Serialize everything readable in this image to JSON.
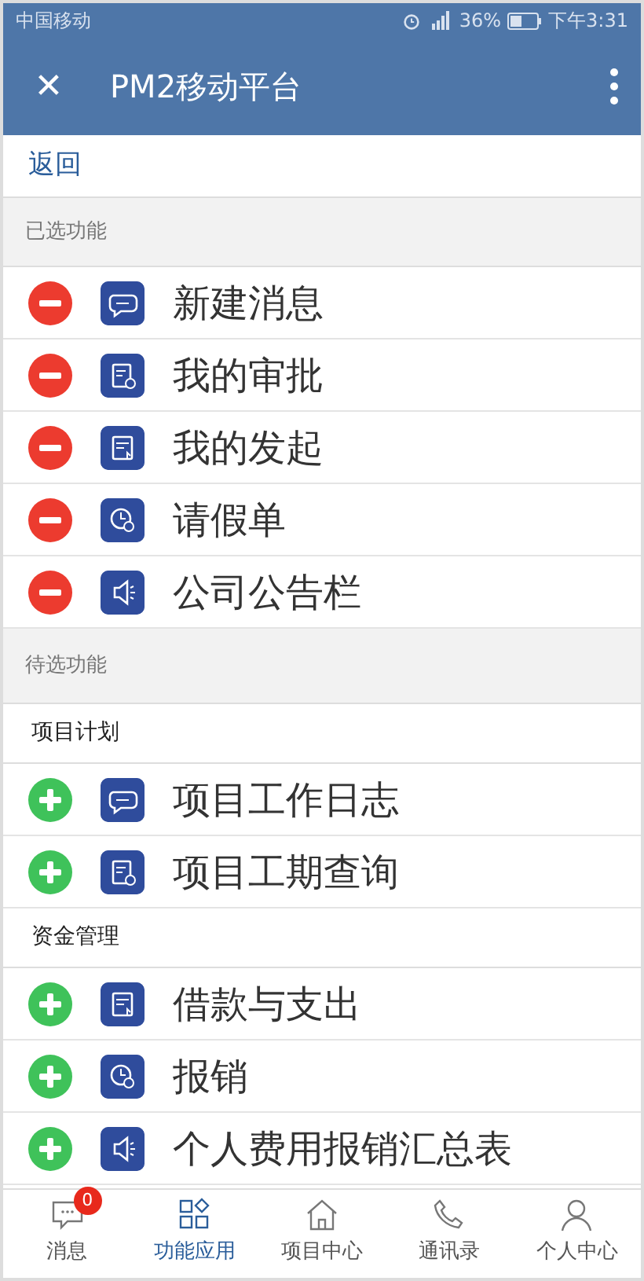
{
  "status_bar": {
    "carrier": "中国移动",
    "battery": "36%",
    "time": "下午3:31"
  },
  "header": {
    "close": "✕",
    "title": "PM2移动平台"
  },
  "back_link": "返回",
  "sections": [
    {
      "title": "已选功能",
      "groups": [
        {
          "items": [
            {
              "kind": "remove",
              "label": "新建消息"
            },
            {
              "kind": "remove",
              "label": "我的审批"
            },
            {
              "kind": "remove",
              "label": "我的发起"
            },
            {
              "kind": "remove",
              "label": "请假单"
            },
            {
              "kind": "remove",
              "label": "公司公告栏"
            }
          ]
        }
      ]
    },
    {
      "title": "待选功能",
      "groups": [
        {
          "title": "项目计划",
          "items": [
            {
              "kind": "add",
              "label": "项目工作日志"
            },
            {
              "kind": "add",
              "label": "项目工期查询"
            }
          ]
        },
        {
          "title": "资金管理",
          "items": [
            {
              "kind": "add",
              "label": "借款与支出"
            },
            {
              "kind": "add",
              "label": "报销"
            },
            {
              "kind": "add",
              "label": "个人费用报销汇总表"
            }
          ]
        }
      ]
    }
  ],
  "tab_bar": [
    {
      "label": "消息",
      "badge": "0",
      "selected": false
    },
    {
      "label": "功能应用",
      "selected": true
    },
    {
      "label": "项目中心",
      "selected": false
    },
    {
      "label": "通讯录",
      "selected": false
    },
    {
      "label": "个人中心",
      "selected": false
    }
  ]
}
